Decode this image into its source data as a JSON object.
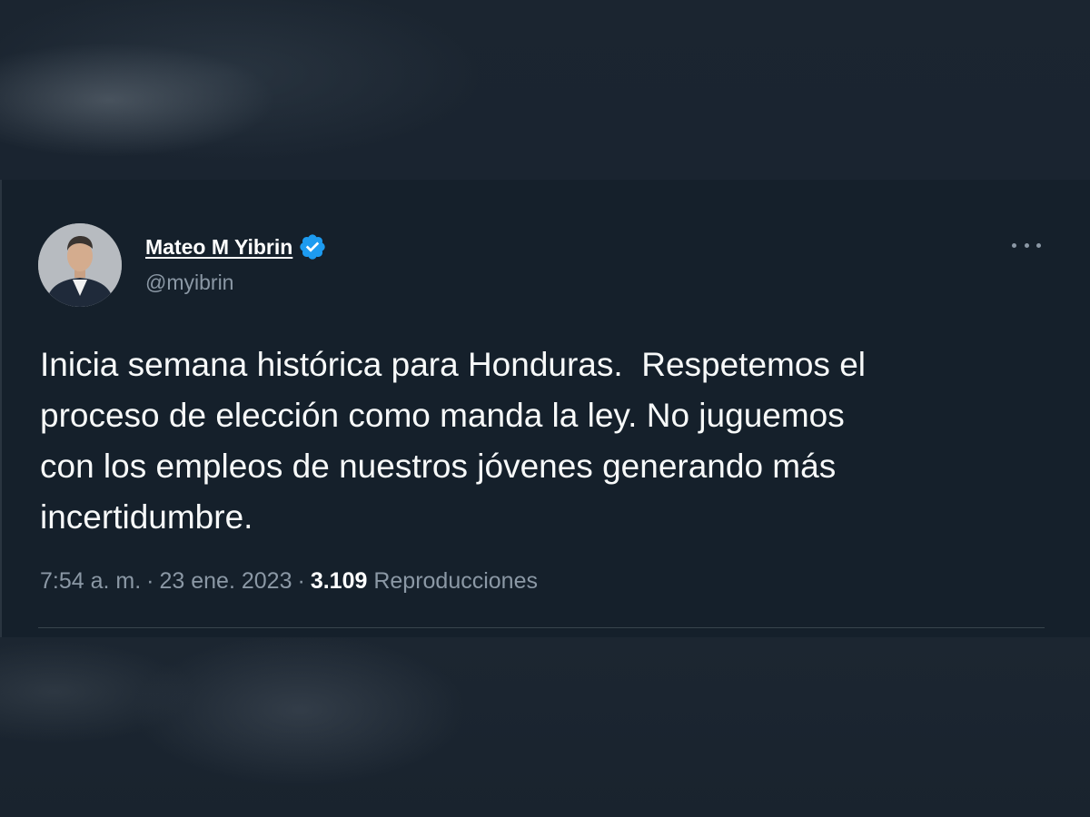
{
  "tweet": {
    "author": {
      "display_name": "Mateo M Yibrin",
      "handle": "@myibrin",
      "verified": true,
      "avatar_icon": "profile-photo"
    },
    "text": "Inicia semana histórica para Honduras.  Respetemos el\nproceso de elección como manda la ley. No juguemos\ncon los empleos de nuestros jóvenes generando más\nincertidumbre.",
    "time": "7:54 a. m.",
    "separator": "·",
    "date": "23 ene. 2023",
    "views_count": "3.109",
    "views_label": "Reproducciones",
    "more_icon": "more-horizontal-icon"
  },
  "colors": {
    "background": "#15202b",
    "text_primary": "#f7f9f9",
    "text_secondary": "#8b98a5",
    "verified_blue": "#1d9bf0",
    "divider": "#38444d"
  }
}
